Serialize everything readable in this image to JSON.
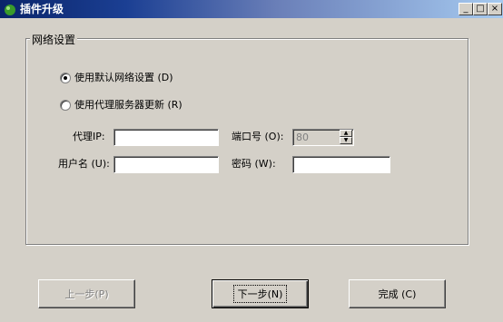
{
  "window": {
    "title": "插件升级",
    "min_label": "_",
    "max_label": "□",
    "close_label": "×"
  },
  "network_group": {
    "legend": "网络设置",
    "option_default": {
      "label": "使用默认网络设置 (D)",
      "checked": true
    },
    "option_proxy": {
      "label": "使用代理服务器更新 (R)",
      "checked": false
    },
    "proxy_ip_label": "代理IP:",
    "proxy_ip_value": "",
    "port_label": "端口号 (O):",
    "port_value": "80",
    "username_label": "用户名 (U):",
    "username_value": "",
    "password_label": "密码 (W):",
    "password_value": ""
  },
  "buttons": {
    "prev": "上一步(P)",
    "next": "下一步(N)",
    "finish": "完成 (C)"
  }
}
